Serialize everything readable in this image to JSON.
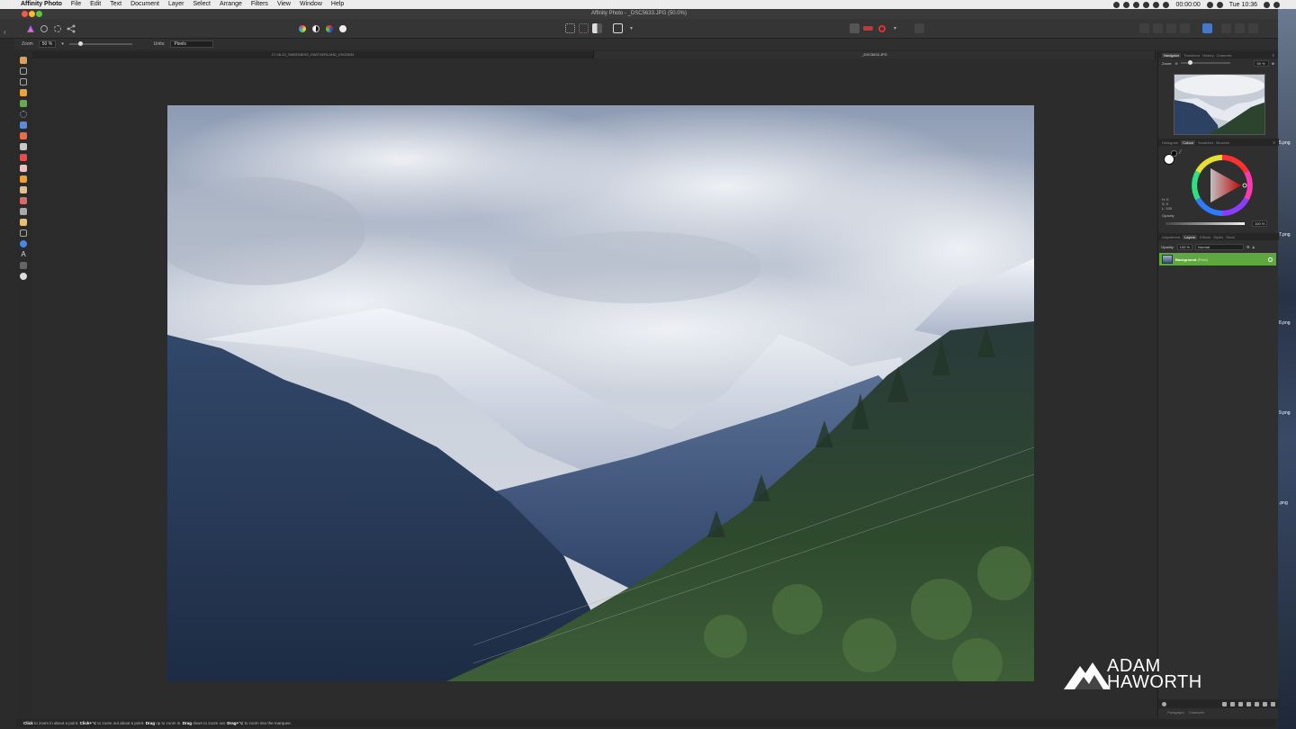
{
  "menubar": {
    "app_name": "Affinity Photo",
    "items": [
      "File",
      "Edit",
      "Text",
      "Document",
      "Layer",
      "Select",
      "Arrange",
      "Filters",
      "View",
      "Window",
      "Help"
    ],
    "timer": "00:00:00",
    "clock": "Tue 10:36"
  },
  "window": {
    "title": "Affinity Photo - _DSC5633.JPG (50.0%)"
  },
  "context_toolbar": {
    "zoom_label": "Zoom",
    "zoom_value": "50 %",
    "units_label": "Units:",
    "units_value": "Pixels"
  },
  "document_tabs": [
    {
      "label": "17-08-10_SWEDNESS_SWITZERLAND_DSC5633"
    },
    {
      "label": "_DSC5633.JPG"
    }
  ],
  "right_panel": {
    "navigator_tabs": [
      "Navigator",
      "Transform",
      "History",
      "Channels"
    ],
    "zoom_label": "Zoom:",
    "zoom_value": "50 %",
    "color_tabs": [
      "Histogram",
      "Colour",
      "Swatches",
      "Brushes"
    ],
    "hsl": {
      "h": "H: 0",
      "s": "S: 0",
      "l": "L: 100"
    },
    "opacity_label": "Opacity",
    "opacity_value": "100 %",
    "layer_tabs": [
      "Adjustment",
      "Layers",
      "Effects",
      "Styles",
      "Stock"
    ],
    "layer_opacity_label": "Opacity:",
    "layer_opacity_value": "100 %",
    "blend_mode": "Normal",
    "layer": {
      "name": "Background",
      "type": "(Pixel)"
    },
    "bottom_tabs": [
      "Paragraph",
      "Character"
    ]
  },
  "statusbar": {
    "click1": "Click",
    "text1": " to zoom in about a point. ",
    "click2": "Click+⌥",
    "text2": " to zoom out about a point. ",
    "drag1": "Drag",
    "text3": " up to zoom in. ",
    "drag2": "Drag",
    "text4": " down to zoom out. ",
    "drag3": "Drag+⌥",
    "text5": " to zoom into the marquee."
  },
  "desktop_labels": [
    "5.png",
    "7.png",
    "8.png",
    "9.png",
    ".png"
  ],
  "watermark": {
    "line1": "ADAM",
    "line2": "HAWORTH"
  },
  "colors": {
    "accent_green": "#5fa83f",
    "panel_bg": "#2f2f2f",
    "canvas_bg": "#2c2c2c"
  }
}
